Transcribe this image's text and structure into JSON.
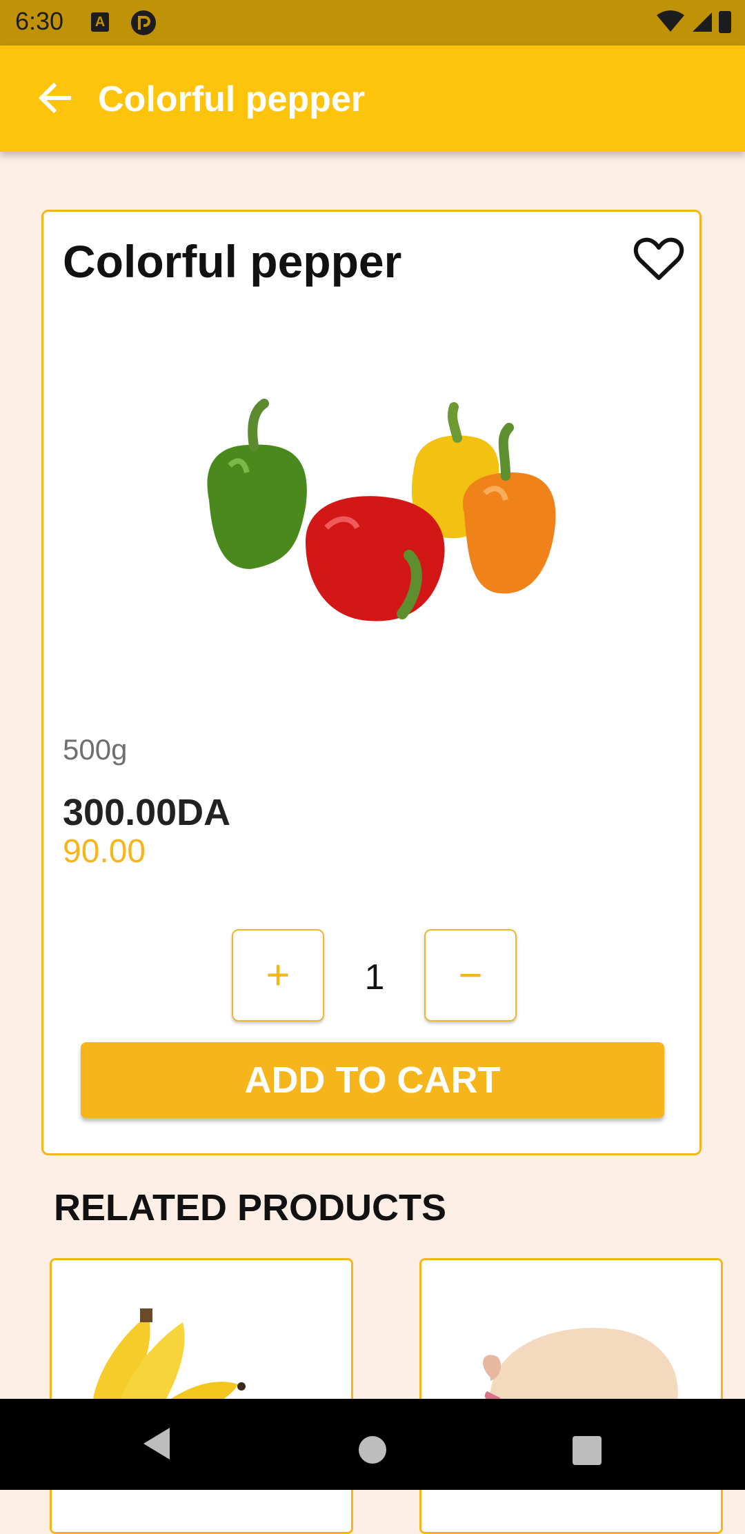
{
  "status_bar": {
    "time": "6:30",
    "icons": [
      "text-badge-icon",
      "launcher-icon",
      "wifi-icon",
      "cell-signal-icon",
      "battery-icon"
    ],
    "badge_text": "A"
  },
  "app_bar": {
    "title": "Colorful pepper",
    "back_icon": "arrow-left-icon"
  },
  "product": {
    "name": "Colorful pepper",
    "favorite_icon": "heart-outline-icon",
    "image": "colorful-peppers-photo",
    "weight": "500g",
    "price": "300.00DA",
    "old_price": "90.00",
    "quantity": "1",
    "plus_label": "+",
    "minus_label": "−",
    "add_to_cart_label": "ADD TO CART"
  },
  "related": {
    "title": "RELATED PRODUCTS",
    "items": [
      {
        "image": "bananas-photo"
      },
      {
        "image": "raw-chicken-photo"
      }
    ]
  },
  "nav_bar": {
    "icons": [
      "nav-back-icon",
      "nav-home-icon",
      "nav-recents-icon"
    ]
  },
  "colors": {
    "accent": "#fec40b",
    "button": "#f5b51b",
    "status_bar": "#bf9207",
    "background": "#fdeee6"
  }
}
